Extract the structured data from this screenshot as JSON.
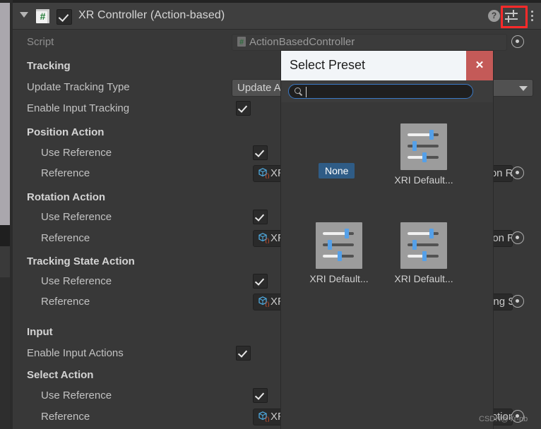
{
  "component": {
    "title": "XR Controller (Action-based)",
    "script_icon": "#",
    "enabled": true,
    "help_icon": "?",
    "preset_icon": "preset-sliders-icon",
    "menu_icon": "kebab-menu-icon"
  },
  "rows": [
    {
      "label": "Script",
      "indent": 0,
      "style": "dim",
      "control": "object",
      "value": "ActionBasedController",
      "icon": "script-hash-icon",
      "readonly": true
    },
    {
      "label": "Tracking",
      "indent": 0,
      "style": "bold",
      "control": "none"
    },
    {
      "label": "Update Tracking Type",
      "indent": 0,
      "style": "norm",
      "control": "enum",
      "value": "Update And Before Render"
    },
    {
      "label": "Enable Input Tracking",
      "indent": 0,
      "style": "norm",
      "control": "check",
      "value": true
    },
    {
      "label": "Position Action",
      "indent": 0,
      "style": "bold",
      "control": "none"
    },
    {
      "label": "Use Reference",
      "indent": 1,
      "style": "norm",
      "control": "check",
      "value": true
    },
    {
      "label": "Reference",
      "indent": 1,
      "style": "norm",
      "control": "object",
      "value": "XRI Default Input Actions/XRI RightHand/Position Ref",
      "icon": "input-action-reference-icon"
    },
    {
      "label": "Rotation Action",
      "indent": 0,
      "style": "bold",
      "control": "none"
    },
    {
      "label": "Use Reference",
      "indent": 1,
      "style": "norm",
      "control": "check",
      "value": true
    },
    {
      "label": "Reference",
      "indent": 1,
      "style": "norm",
      "control": "object",
      "value": "XRI Default Input Actions/XRI RightHand/Rotation Re",
      "icon": "input-action-reference-icon"
    },
    {
      "label": "Tracking State Action",
      "indent": 0,
      "style": "bold",
      "control": "none"
    },
    {
      "label": "Use Reference",
      "indent": 1,
      "style": "norm",
      "control": "check",
      "value": true
    },
    {
      "label": "Reference",
      "indent": 1,
      "style": "norm",
      "control": "object",
      "value": "XRI Default Input Actions/XRI RightHand/Tracking State Act",
      "icon": "input-action-reference-icon"
    },
    {
      "label": "",
      "indent": 0,
      "style": "norm",
      "control": "none"
    },
    {
      "label": "Input",
      "indent": 0,
      "style": "bold",
      "control": "none"
    },
    {
      "label": "Enable Input Actions",
      "indent": 0,
      "style": "norm",
      "control": "check",
      "value": true
    },
    {
      "label": "Select Action",
      "indent": 0,
      "style": "bold",
      "control": "none"
    },
    {
      "label": "Use Reference",
      "indent": 1,
      "style": "norm",
      "control": "check",
      "value": true
    },
    {
      "label": "Reference",
      "indent": 1,
      "style": "norm",
      "control": "object",
      "value": "XRI Default Input Actions/XRI RightHand Interaction/Select ut",
      "icon": "input-action-reference-icon"
    }
  ],
  "preset_window": {
    "title": "Select Preset",
    "close_label": "✕",
    "search_value": "",
    "search_placeholder": "",
    "items": [
      {
        "label": "None",
        "kind": "none"
      },
      {
        "label": "XRI Default...",
        "kind": "preset"
      },
      {
        "label": "XRI Default...",
        "kind": "preset"
      },
      {
        "label": "XRI Default...",
        "kind": "preset"
      }
    ]
  },
  "watermark": "CSDN@Yr-nb",
  "colors": {
    "panel_bg": "#383838",
    "header_bg": "#3f3f3f",
    "accent_blue": "#3a79c6",
    "close_red": "#c45a58",
    "highlight_red": "#ff2a2a",
    "selected_blue": "#2f5c86",
    "slider_knob": "#55a0e8"
  }
}
